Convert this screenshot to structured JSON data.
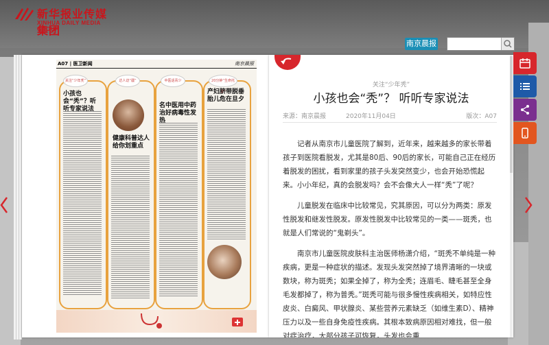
{
  "brand": {
    "name_cn": "新华报业传媒集团",
    "name_en": "XINHUA DAILY MEDIA GROUP"
  },
  "header": {
    "paper_name": "南京晨报",
    "search": {
      "value": "",
      "placeholder": ""
    }
  },
  "newspaper_page": {
    "page_label": "A07 | 医卫新闻",
    "masthead": "南京晨报",
    "stories": [
      {
        "tag": "关注“少年秃”",
        "headline": "小孩也会“秃”？听听专家说法"
      },
      {
        "tag": "达人访“疆”",
        "headline": "健康科普达人给你划重点"
      },
      {
        "tag": "中医话青少",
        "headline": "名中医用中药治好病毒性发热"
      },
      {
        "tag": "20分钟“生命托举”",
        "headline": "产妇脐带脱垂胎儿危在旦夕"
      }
    ]
  },
  "article": {
    "kicker": "关注“少年秃”",
    "title": "小孩也会“秃”？ 听听专家说法",
    "source": "来源：南京晨报",
    "date": "2020年11月04日",
    "edition": "版次：A07",
    "paragraphs": [
      "记者从南京市儿童医院了解到，近年来，越来越多的家长带着孩子到医院看脱发，尤其是80后、90后的家长，可能自己正在经历着脱发的困扰，看到家里的孩子头发突然变少，也会开始恐慌起来。小小年纪，真的会脱发吗？会不会像大人一样“秃”了呢？",
      "儿童脱发在临床中比较常见，究其原因，可以分为两类：原发性脱发和继发性脱发。原发性脱发中比较常见的一类——斑秃，也就是人们常说的“鬼剃头”。",
      "南京市儿童医院皮肤科主治医师杨潇介绍，“斑秃不单纯是一种疾病，更是一种症状的描述。发现头发突然掉了境界清晰的一块或数块，称为斑秃；如果全掉了，称为全秃；连眉毛、睫毛甚至全身毛发都掉了，称为普秃。”斑秃可能与很多慢性疾病相关，如特应性皮炎、白癜风、甲状腺炎、某些营养元素缺乏（如维生素D）、精神压力以及一些自身免疫性疾病。其根本致病原因相对难找，但一般对症治疗，大部分孩子可恢复，头发也会重"
    ]
  },
  "tools": [
    {
      "name": "calendar-icon",
      "color": "#d7262c"
    },
    {
      "name": "list-icon",
      "color": "#1e5aa8"
    },
    {
      "name": "share-icon",
      "color": "#7b2f8f"
    },
    {
      "name": "mobile-icon",
      "color": "#e2561f"
    }
  ],
  "colors": {
    "accent": "#d7262c",
    "tag_blue": "#1b8fb6",
    "frame_orange": "#e8a23e"
  }
}
